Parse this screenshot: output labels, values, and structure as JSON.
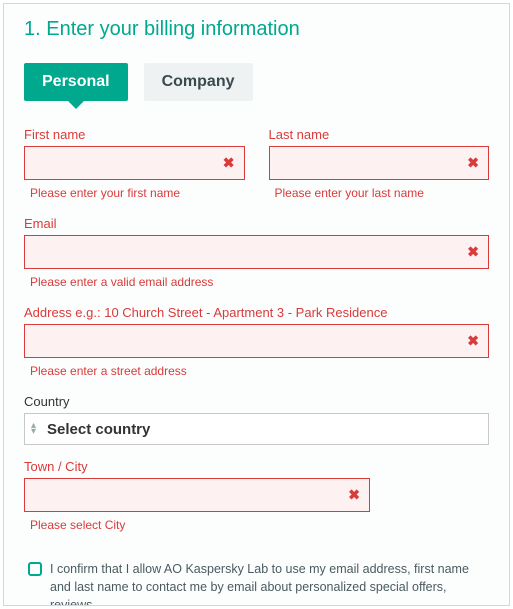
{
  "heading": "1. Enter your billing information",
  "tabs": {
    "personal": "Personal",
    "company": "Company"
  },
  "fields": {
    "first_name": {
      "label": "First name",
      "error": "Please enter your first name"
    },
    "last_name": {
      "label": "Last name",
      "error": "Please enter your last name"
    },
    "email": {
      "label": "Email",
      "error": "Please enter a valid email address"
    },
    "address": {
      "label": "Address e.g.: 10 Church Street - Apartment 3 - Park Residence",
      "error": "Please enter a street address"
    },
    "country": {
      "label": "Country",
      "placeholder": "Select country"
    },
    "town": {
      "label": "Town / City",
      "error": "Please select City"
    }
  },
  "consent": {
    "text": "I confirm that I allow AO Kaspersky Lab to use my email address, first name and last name to contact me by email about personalized special offers, reviews,"
  },
  "icons": {
    "clear": "✖"
  }
}
